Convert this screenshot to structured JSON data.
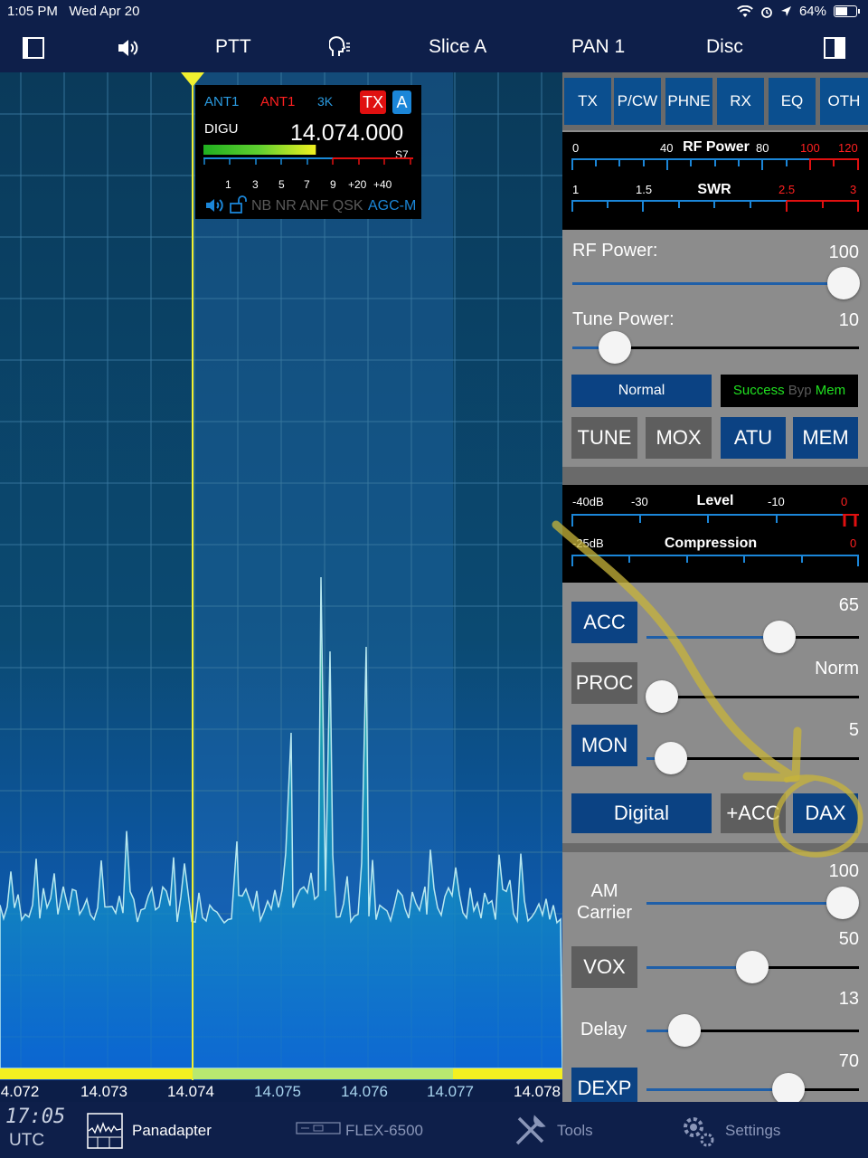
{
  "status_bar": {
    "time": "1:05 PM",
    "date": "Wed Apr 20",
    "battery": "64%",
    "battery_level": 0.64
  },
  "toolbar": {
    "ptt": "PTT",
    "slice": "Slice A",
    "pan": "PAN 1",
    "disc": "Disc"
  },
  "slice_flag": {
    "rx_ant": "ANT1",
    "tx_ant": "ANT1",
    "filter": "3K",
    "tx_badge": "TX",
    "slice_letter": "A",
    "mode": "DIGU",
    "frequency": "14.074.000",
    "s_reading": "S7",
    "signal_level": 0.55,
    "scale": [
      "1",
      "3",
      "5",
      "7",
      "9",
      "+20",
      "+40"
    ],
    "flags": "NB NR ANF QSK",
    "agc": "AGC-M"
  },
  "freq_axis": [
    "4.072",
    "14.073",
    "14.074",
    "14.075",
    "14.076",
    "14.077",
    "14.078"
  ],
  "tabs": [
    "TX",
    "P/CW",
    "PHNE",
    "RX",
    "EQ",
    "OTH"
  ],
  "rf_meter": {
    "title": "RF Power",
    "labels": [
      "0",
      "40",
      "80",
      "100",
      "120"
    ],
    "swr_title": "SWR",
    "swr_labels": [
      "1",
      "1.5",
      "2.5",
      "3"
    ]
  },
  "rf_power": {
    "label": "RF Power:",
    "value": "100",
    "level": 1.0
  },
  "tune_power": {
    "label": "Tune Power:",
    "value": "10",
    "level": 0.1
  },
  "atu": {
    "mode": "Normal",
    "status_success": "Success",
    "status_byp": "Byp",
    "status_mem": "Mem"
  },
  "tx_buttons": [
    "TUNE",
    "MOX",
    "ATU",
    "MEM"
  ],
  "level_meter": {
    "title": "Level",
    "labels": [
      "-40dB",
      "-30",
      "-10",
      "0"
    ],
    "comp_title": "Compression",
    "comp_labels": [
      "-25dB",
      "0"
    ]
  },
  "acc": {
    "label": "ACC",
    "value": "65",
    "level": 0.65
  },
  "proc": {
    "label": "PROC",
    "value": "Norm",
    "level": 0.0
  },
  "mon": {
    "label": "MON",
    "value": "5",
    "level": 0.05
  },
  "source_buttons": [
    "Digital",
    "+ACC",
    "DAX"
  ],
  "am_carrier": {
    "label_line1": "AM",
    "label_line2": "Carrier",
    "value": "100",
    "level": 1.0
  },
  "vox": {
    "label": "VOX",
    "value": "50",
    "level": 0.5
  },
  "delay": {
    "label": "Delay",
    "value": "13",
    "level": 0.1
  },
  "dexp": {
    "label": "DEXP",
    "value": "70",
    "level": 0.7
  },
  "bottom_bar": {
    "clock": "17:05",
    "tz": "UTC",
    "panadapter": "Panadapter",
    "radio": "FLEX-6500",
    "tools": "Tools",
    "settings": "Settings"
  }
}
